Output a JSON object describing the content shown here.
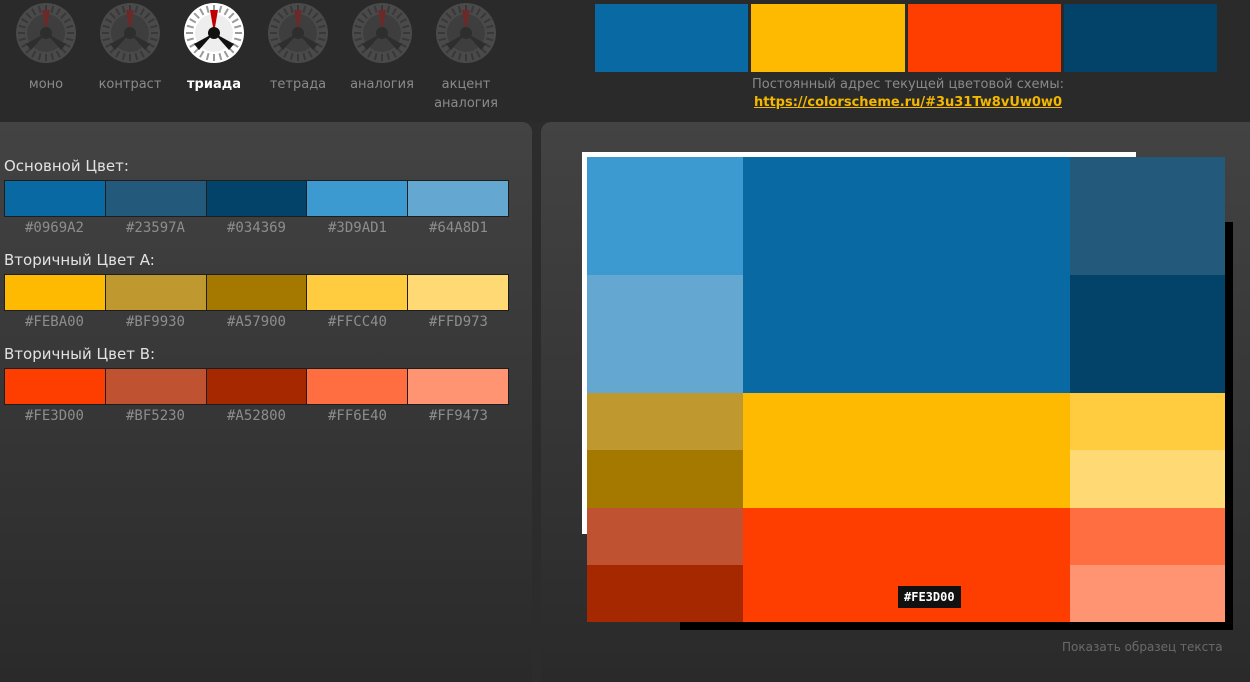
{
  "modes": [
    {
      "label": "моно",
      "icon": "mono-wheel-icon",
      "active": false
    },
    {
      "label": "контраст",
      "icon": "contrast-wheel-icon",
      "active": false
    },
    {
      "label": "триада",
      "icon": "triad-wheel-icon",
      "active": true
    },
    {
      "label": "тетрада",
      "icon": "tetrad-wheel-icon",
      "active": false
    },
    {
      "label": "аналогия",
      "icon": "analogy-wheel-icon",
      "active": false
    },
    {
      "label": "акцент\nаналогия",
      "icon": "accent-analogy-wheel-icon",
      "active": false
    }
  ],
  "scheme_swatches": [
    "#0969A2",
    "#FEBA00",
    "#FE3D00",
    "#034369"
  ],
  "permalink": {
    "text": "Постоянный адрес текущей цветовой схемы:",
    "url": "https://colorscheme.ru/#3u31Tw8vUw0w0"
  },
  "groups": [
    {
      "title": "Основной Цвет:",
      "colors": [
        "#0969A2",
        "#23597A",
        "#034369",
        "#3D9AD1",
        "#64A8D1"
      ]
    },
    {
      "title": "Вторичный Цвет A:",
      "colors": [
        "#FEBA00",
        "#BF9930",
        "#A57900",
        "#FFCC40",
        "#FFD973"
      ]
    },
    {
      "title": "Вторичный Цвет B:",
      "colors": [
        "#FE3D00",
        "#BF5230",
        "#A52800",
        "#FF6E40",
        "#FF9473"
      ]
    }
  ],
  "tooltip": "#FE3D00",
  "show_sample": "Показать образец текста"
}
